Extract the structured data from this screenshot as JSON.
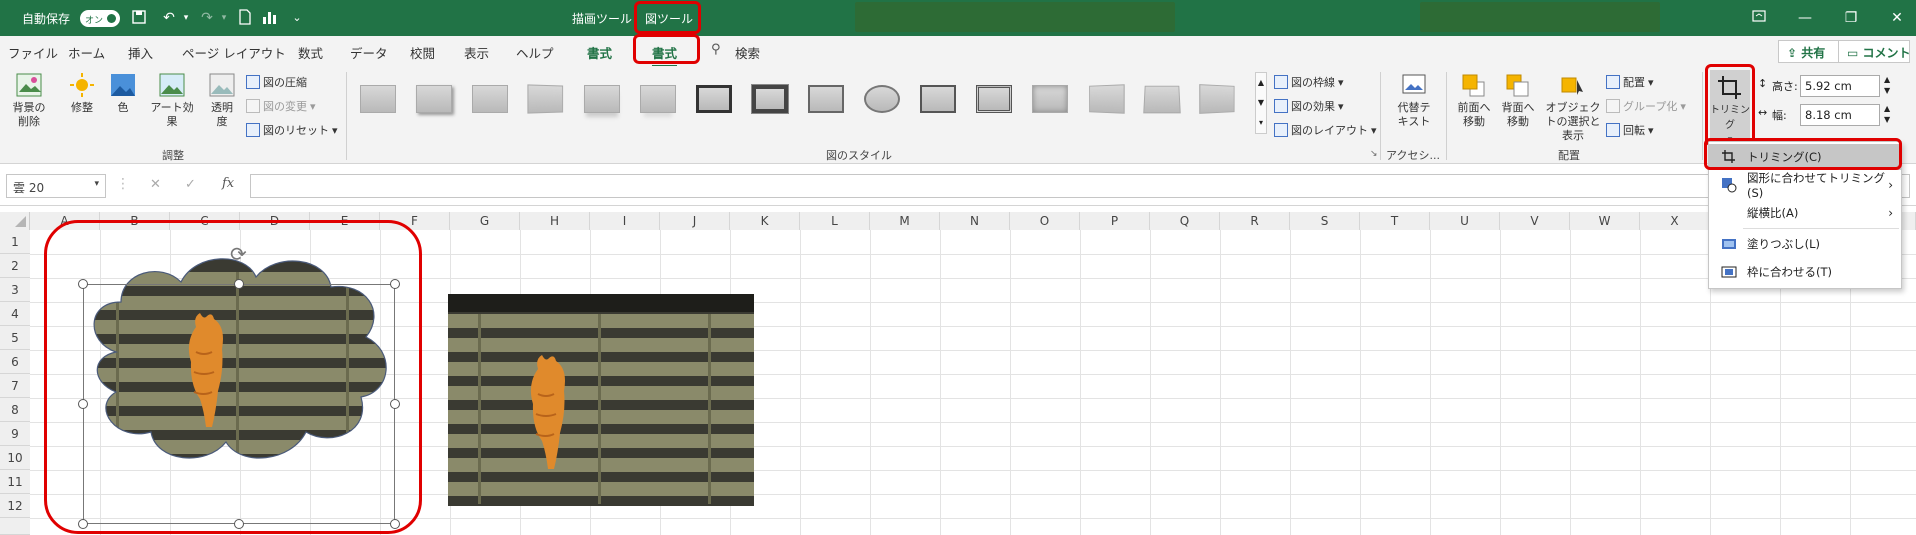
{
  "titlebar": {
    "autosave_label": "自動保存",
    "autosave_toggle": "オン",
    "context_tab_drawing": "描画ツール",
    "context_tab_picture": "図ツール",
    "more_label": "⌄"
  },
  "menu": {
    "items": [
      "ファイル",
      "ホーム",
      "挿入",
      "ページ レイアウト",
      "数式",
      "データ",
      "校閲",
      "表示",
      "ヘルプ",
      "書式",
      "書式"
    ],
    "search": "検索",
    "share": "共有",
    "comment": "コメント"
  },
  "ribbon": {
    "adjust": {
      "remove_bg": "背景の削除",
      "corrections": "修整",
      "color": "色",
      "artistic": "アート効果",
      "transparency": "透明度",
      "compress": "図の圧縮",
      "change": "図の変更",
      "reset": "図のリセット",
      "group_label": "調整"
    },
    "styles": {
      "border": "図の枠線",
      "effects": "図の効果",
      "layout": "図のレイアウト",
      "group_label": "図のスタイル"
    },
    "accessibility": {
      "alt_text": "代替テキスト",
      "group_label": "アクセシ..."
    },
    "arrange": {
      "bring_forward": "前面へ移動",
      "send_backward": "背面へ移動",
      "selection_pane": "オブジェクトの選択と表示",
      "align": "配置",
      "group": "グループ化",
      "rotate": "回転",
      "group_label": "配置"
    },
    "size": {
      "crop": "トリミング",
      "height_label": "高さ:",
      "height_value": "5.92 cm",
      "width_label": "幅:",
      "width_value": "8.18 cm"
    }
  },
  "formula_bar": {
    "name_box": "雲 20",
    "cancel": "✕",
    "enter": "✓",
    "fx": "fx"
  },
  "grid": {
    "columns": [
      "A",
      "B",
      "C",
      "D",
      "E",
      "F",
      "G",
      "H",
      "I",
      "J",
      "K",
      "L",
      "M",
      "N",
      "O",
      "P",
      "Q",
      "R",
      "S",
      "T",
      "U",
      "V",
      "W",
      "X"
    ],
    "rows": [
      "1",
      "2",
      "3",
      "4",
      "5",
      "6",
      "7",
      "8",
      "9",
      "10",
      "11",
      "12"
    ]
  },
  "crop_menu": {
    "items": [
      {
        "label": "トリミング(C)",
        "icon": "crop-icon",
        "submenu": false
      },
      {
        "label": "図形に合わせてトリミング(S)",
        "icon": "shape-crop-icon",
        "submenu": true
      },
      {
        "label": "縦横比(A)",
        "icon": "",
        "submenu": true
      },
      {
        "label": "塗りつぶし(L)",
        "icon": "fill-icon",
        "submenu": false
      },
      {
        "label": "枠に合わせる(T)",
        "icon": "fit-icon",
        "submenu": false
      }
    ]
  },
  "colors": {
    "excel_green": "#217346",
    "highlight_red": "#e00000"
  }
}
